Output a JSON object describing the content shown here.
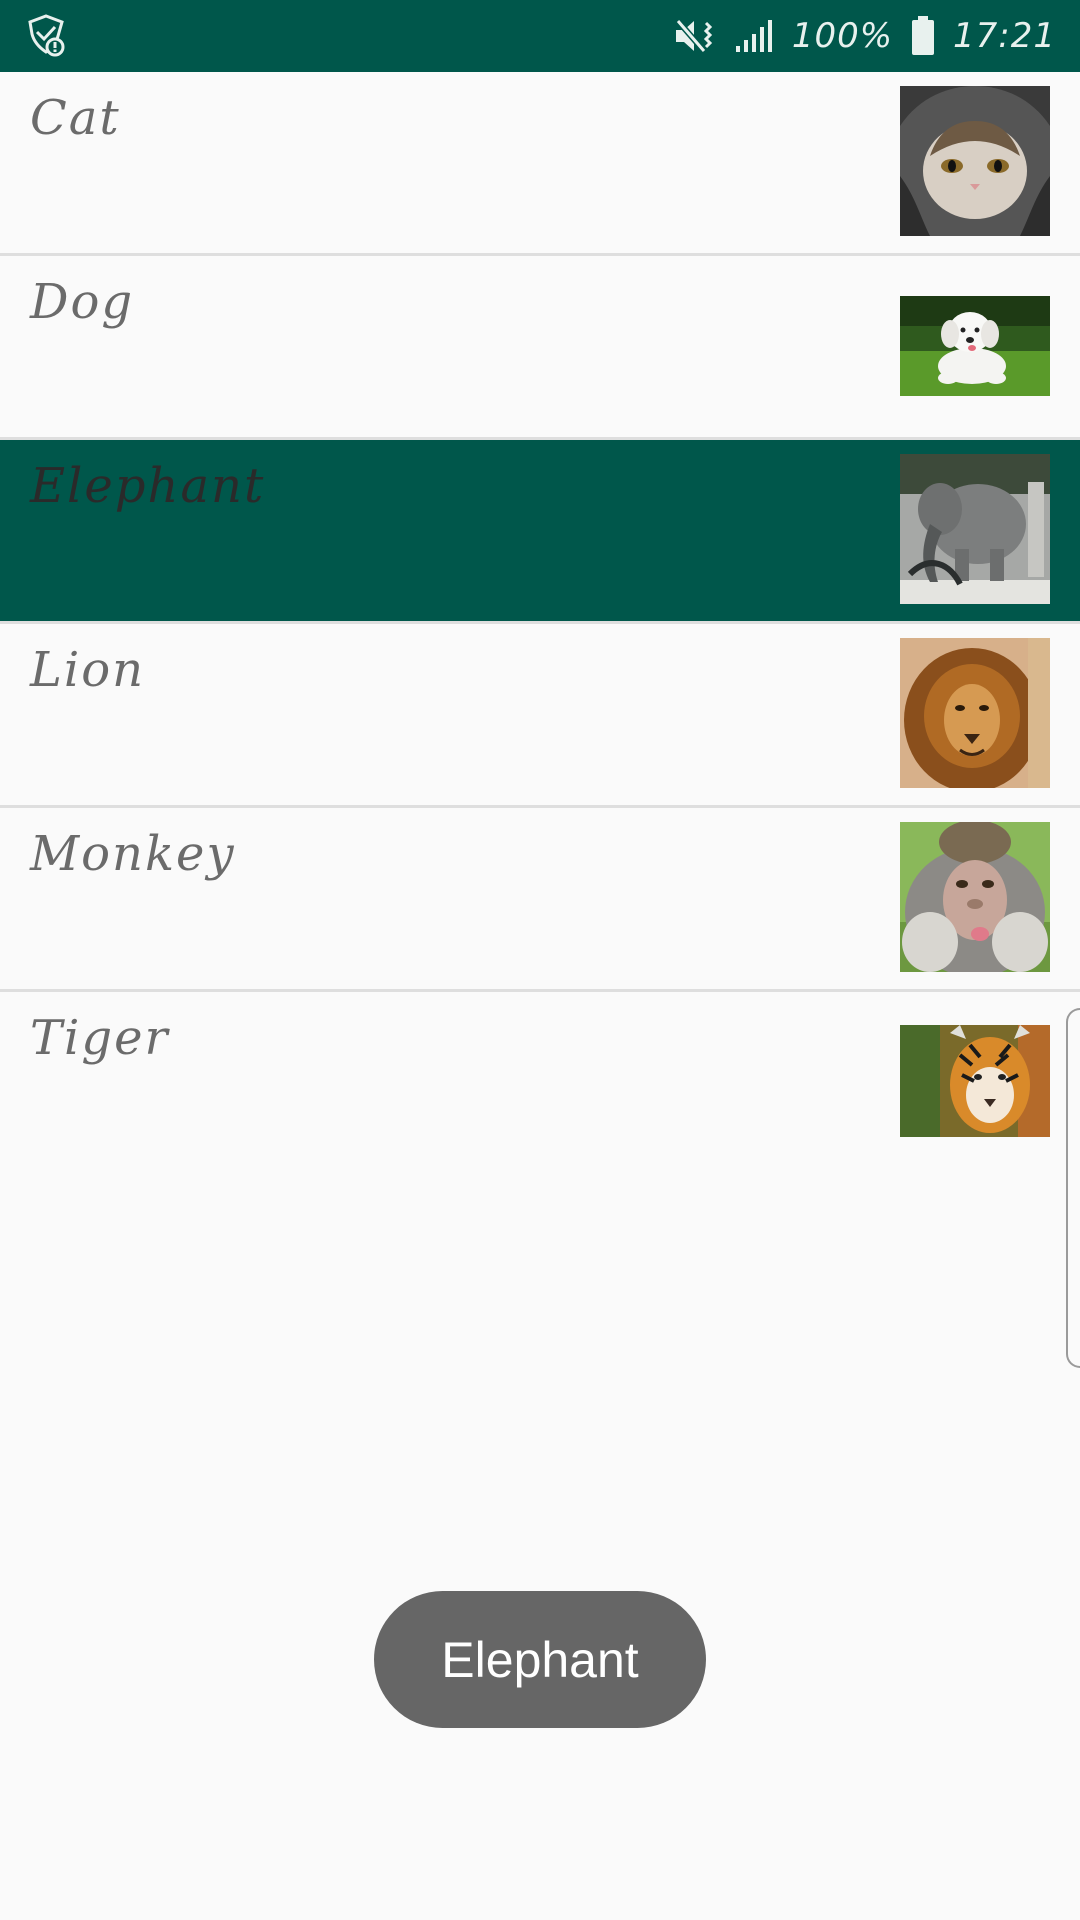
{
  "status_bar": {
    "battery_percent": "100%",
    "time": "17:21",
    "icons": [
      "shield-check-icon",
      "mute-vibrate-icon",
      "signal-icon",
      "battery-icon"
    ],
    "background_color": "#00574b"
  },
  "list": {
    "items": [
      {
        "label": "Cat",
        "image": "cat-photo",
        "selected": false
      },
      {
        "label": "Dog",
        "image": "dog-photo",
        "selected": false
      },
      {
        "label": "Elephant",
        "image": "elephant-photo",
        "selected": true
      },
      {
        "label": "Lion",
        "image": "lion-photo",
        "selected": false
      },
      {
        "label": "Monkey",
        "image": "monkey-photo",
        "selected": false
      },
      {
        "label": "Tiger",
        "image": "tiger-photo",
        "selected": false
      }
    ],
    "selected_color": "#00574b"
  },
  "toast": {
    "text": "Elephant",
    "background_color": "#666666"
  }
}
